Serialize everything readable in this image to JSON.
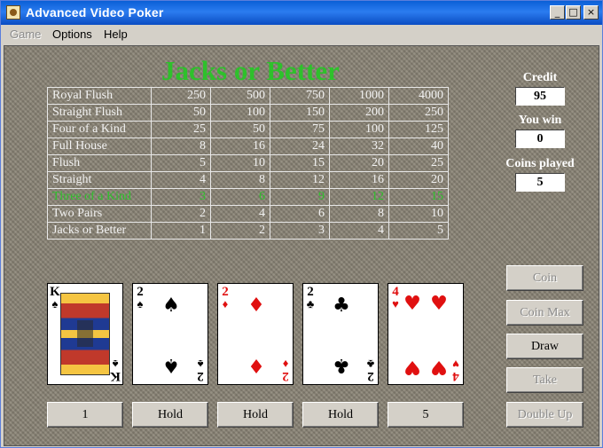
{
  "window": {
    "title": "Advanced Video Poker"
  },
  "menu": [
    {
      "label": "Game",
      "enabled": false
    },
    {
      "label": "Options",
      "enabled": true
    },
    {
      "label": "Help",
      "enabled": true
    }
  ],
  "game_title": "Jacks or Better",
  "paytable": {
    "rows": [
      {
        "hand": "Royal Flush",
        "pays": [
          "250",
          "500",
          "750",
          "1000",
          "4000"
        ]
      },
      {
        "hand": "Straight Flush",
        "pays": [
          "50",
          "100",
          "150",
          "200",
          "250"
        ]
      },
      {
        "hand": "Four of a Kind",
        "pays": [
          "25",
          "50",
          "75",
          "100",
          "125"
        ]
      },
      {
        "hand": "Full House",
        "pays": [
          "8",
          "16",
          "24",
          "32",
          "40"
        ]
      },
      {
        "hand": "Flush",
        "pays": [
          "5",
          "10",
          "15",
          "20",
          "25"
        ]
      },
      {
        "hand": "Straight",
        "pays": [
          "4",
          "8",
          "12",
          "16",
          "20"
        ]
      },
      {
        "hand": "Three of a Kind",
        "pays": [
          "3",
          "6",
          "9",
          "12",
          "15"
        ],
        "highlight": true
      },
      {
        "hand": "Two Pairs",
        "pays": [
          "2",
          "4",
          "6",
          "8",
          "10"
        ]
      },
      {
        "hand": "Jacks or Better",
        "pays": [
          "1",
          "2",
          "3",
          "4",
          "5"
        ]
      }
    ],
    "highlight_color": "#2ec12b"
  },
  "status": {
    "credit_label": "Credit",
    "credit": "95",
    "win_label": "You win",
    "win": "0",
    "coins_label": "Coins played",
    "coins": "5"
  },
  "cards": [
    {
      "rank": "K",
      "suit": "♠",
      "color": "black"
    },
    {
      "rank": "2",
      "suit": "♠",
      "color": "black"
    },
    {
      "rank": "2",
      "suit": "♦",
      "color": "red"
    },
    {
      "rank": "2",
      "suit": "♣",
      "color": "black"
    },
    {
      "rank": "4",
      "suit": "♥",
      "color": "red"
    }
  ],
  "hold_buttons": [
    "1",
    "Hold",
    "Hold",
    "Hold",
    "5"
  ],
  "actions": {
    "coin": "Coin",
    "coin_max": "Coin Max",
    "draw": "Draw",
    "take": "Take",
    "double_up": "Double Up"
  }
}
